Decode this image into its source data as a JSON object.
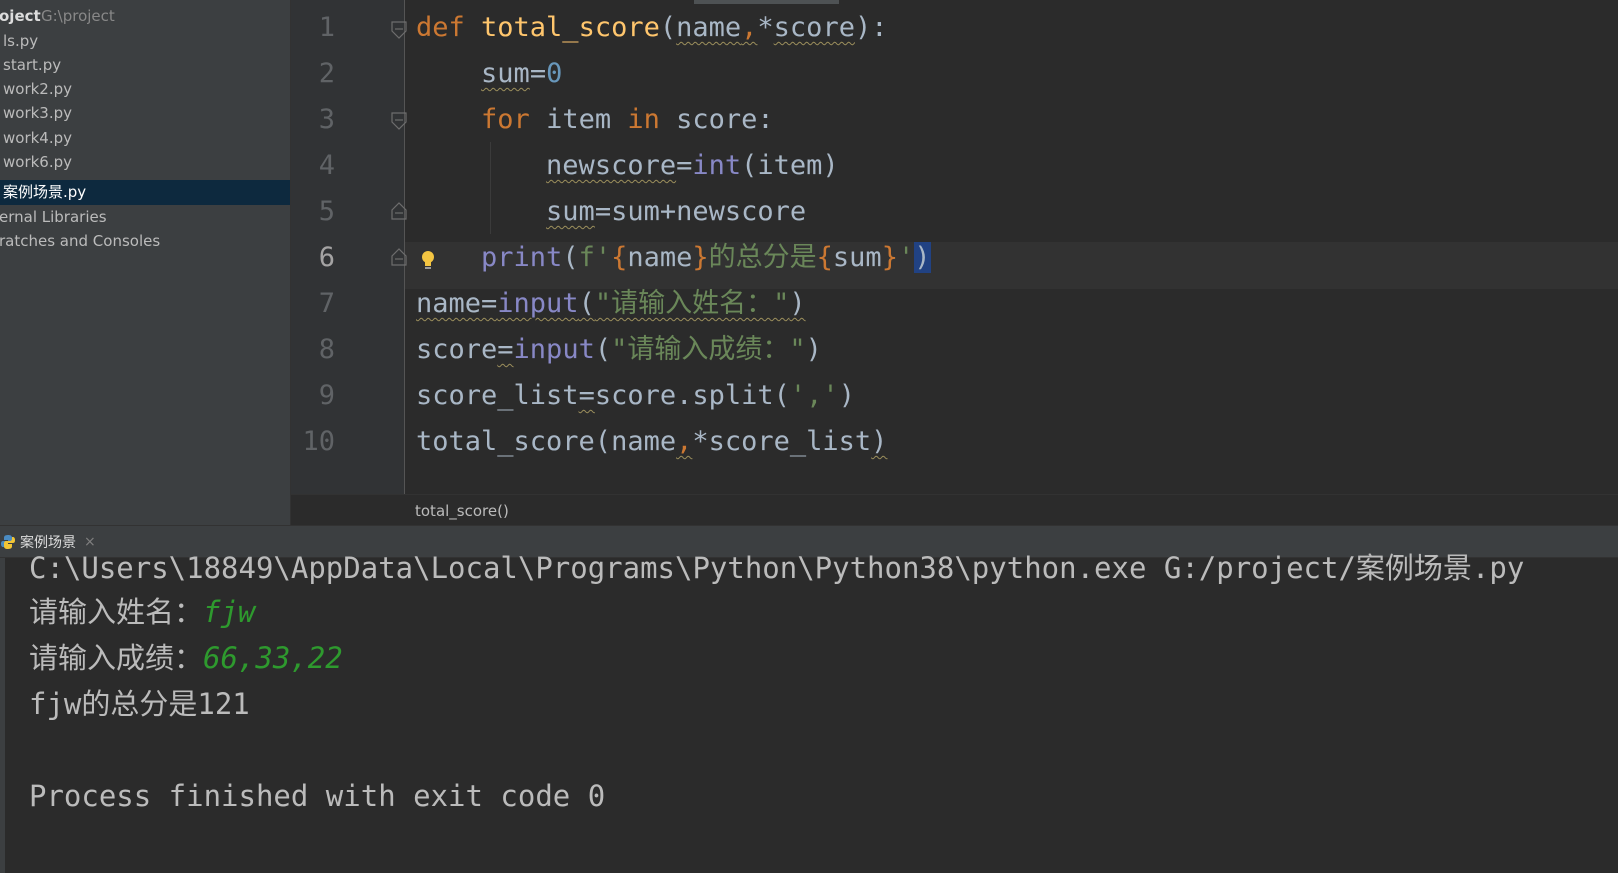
{
  "project": {
    "root_name": "oject",
    "root_path": "G:\\project",
    "files": [
      "ls.py",
      "start.py",
      "work2.py",
      "work3.py",
      "work4.py",
      "work6.py",
      "案例场景.py"
    ],
    "selected_file": "案例场景.py",
    "external_libraries": "ernal Libraries",
    "scratches": "ratches and Consoles"
  },
  "editor": {
    "line_numbers": [
      "1",
      "2",
      "3",
      "4",
      "5",
      "6",
      "7",
      "8",
      "9",
      "10"
    ],
    "current_line": "6",
    "lines": [
      [
        [
          "kw",
          "def "
        ],
        [
          "fn",
          "total_score"
        ],
        [
          "pl",
          "("
        ],
        [
          "pl-w",
          "name"
        ],
        [
          "kw-w",
          ","
        ],
        [
          "pl",
          "*"
        ],
        [
          "pl-w",
          "score"
        ],
        [
          "pl",
          "):"
        ]
      ],
      [
        [
          "pl",
          "    "
        ],
        [
          "pl-w",
          "sum"
        ],
        [
          "pl",
          "="
        ],
        [
          "num",
          "0"
        ]
      ],
      [
        [
          "pl",
          "    "
        ],
        [
          "kw",
          "for "
        ],
        [
          "pl",
          "item "
        ],
        [
          "kw",
          "in "
        ],
        [
          "pl",
          "score:"
        ]
      ],
      [
        [
          "pl",
          "        "
        ],
        [
          "pl-w",
          "newscore"
        ],
        [
          "pl",
          "="
        ],
        [
          "bi",
          "int"
        ],
        [
          "pl",
          "(item)"
        ]
      ],
      [
        [
          "pl",
          "        "
        ],
        [
          "pl-w",
          "sum"
        ],
        [
          "pl",
          "=sum+newscore"
        ]
      ],
      [
        [
          "pl",
          "    "
        ],
        [
          "bi",
          "print"
        ],
        [
          "pl",
          "("
        ],
        [
          "str",
          "f'"
        ],
        [
          "brace",
          "{"
        ],
        [
          "pl",
          "name"
        ],
        [
          "brace",
          "}"
        ],
        [
          "str",
          "的总分是"
        ],
        [
          "brace",
          "{"
        ],
        [
          "pl",
          "sum"
        ],
        [
          "brace",
          "}"
        ],
        [
          "str",
          "'"
        ],
        [
          "hl",
          ")"
        ]
      ],
      [
        [
          "pl-w",
          "name="
        ],
        [
          "bi-w",
          "input"
        ],
        [
          "pl-w",
          "("
        ],
        [
          "str-w",
          "\"请输入姓名：\""
        ],
        [
          "pl",
          ""
        ],
        [
          "pl-w",
          ")"
        ]
      ],
      [
        [
          "pl",
          "score"
        ],
        [
          "pl-w",
          "="
        ],
        [
          "bi",
          "input"
        ],
        [
          "pl",
          "("
        ],
        [
          "str",
          "\"请输入成绩：\""
        ],
        [
          "pl",
          ")"
        ]
      ],
      [
        [
          "pl",
          "score_list"
        ],
        [
          "pl-w",
          "="
        ],
        [
          "pl",
          "score.split("
        ],
        [
          "str",
          "','"
        ],
        [
          "pl",
          ")"
        ]
      ],
      [
        [
          "pl",
          "total_score(name"
        ],
        [
          "kw-w",
          ","
        ],
        [
          "pl",
          "*score_list"
        ],
        [
          "pl-w",
          ")"
        ]
      ]
    ],
    "breadcrumb": "total_score()"
  },
  "run": {
    "tab_label": "案例场景",
    "close_glyph": "×",
    "console": {
      "command": "C:\\Users\\18849\\AppData\\Local\\Programs\\Python\\Python38\\python.exe G:/project/案例场景.py",
      "prompt_name": "请输入姓名：",
      "input_name": "fjw",
      "prompt_score": "请输入成绩：",
      "input_score": "66,33,22",
      "result": "fjw的总分是121",
      "exit_message": "Process finished with exit code 0"
    }
  },
  "colors": {
    "keyword": "#cc7832",
    "function": "#ffc66d",
    "builtin": "#8888c6",
    "number": "#6897bb",
    "string": "#6a8759",
    "text": "#a9b7c6",
    "console_input": "#2e9a2e"
  }
}
